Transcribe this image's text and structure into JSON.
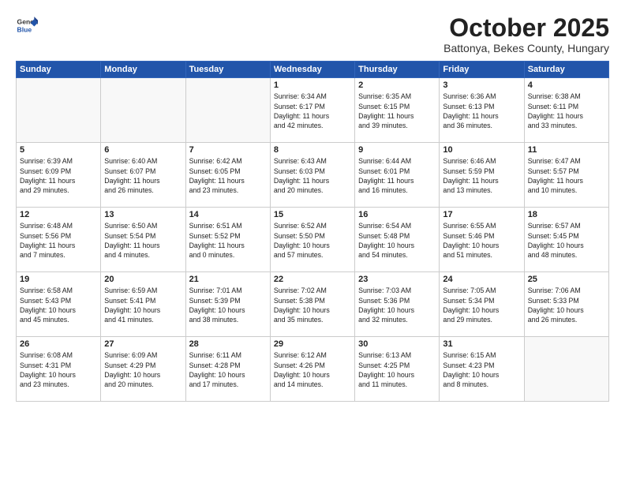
{
  "header": {
    "logo": {
      "line1": "General",
      "line2": "Blue"
    },
    "title": "October 2025",
    "subtitle": "Battonya, Bekes County, Hungary"
  },
  "weekdays": [
    "Sunday",
    "Monday",
    "Tuesday",
    "Wednesday",
    "Thursday",
    "Friday",
    "Saturday"
  ],
  "weeks": [
    [
      {
        "day": "",
        "info": ""
      },
      {
        "day": "",
        "info": ""
      },
      {
        "day": "",
        "info": ""
      },
      {
        "day": "1",
        "info": "Sunrise: 6:34 AM\nSunset: 6:17 PM\nDaylight: 11 hours\nand 42 minutes."
      },
      {
        "day": "2",
        "info": "Sunrise: 6:35 AM\nSunset: 6:15 PM\nDaylight: 11 hours\nand 39 minutes."
      },
      {
        "day": "3",
        "info": "Sunrise: 6:36 AM\nSunset: 6:13 PM\nDaylight: 11 hours\nand 36 minutes."
      },
      {
        "day": "4",
        "info": "Sunrise: 6:38 AM\nSunset: 6:11 PM\nDaylight: 11 hours\nand 33 minutes."
      }
    ],
    [
      {
        "day": "5",
        "info": "Sunrise: 6:39 AM\nSunset: 6:09 PM\nDaylight: 11 hours\nand 29 minutes."
      },
      {
        "day": "6",
        "info": "Sunrise: 6:40 AM\nSunset: 6:07 PM\nDaylight: 11 hours\nand 26 minutes."
      },
      {
        "day": "7",
        "info": "Sunrise: 6:42 AM\nSunset: 6:05 PM\nDaylight: 11 hours\nand 23 minutes."
      },
      {
        "day": "8",
        "info": "Sunrise: 6:43 AM\nSunset: 6:03 PM\nDaylight: 11 hours\nand 20 minutes."
      },
      {
        "day": "9",
        "info": "Sunrise: 6:44 AM\nSunset: 6:01 PM\nDaylight: 11 hours\nand 16 minutes."
      },
      {
        "day": "10",
        "info": "Sunrise: 6:46 AM\nSunset: 5:59 PM\nDaylight: 11 hours\nand 13 minutes."
      },
      {
        "day": "11",
        "info": "Sunrise: 6:47 AM\nSunset: 5:57 PM\nDaylight: 11 hours\nand 10 minutes."
      }
    ],
    [
      {
        "day": "12",
        "info": "Sunrise: 6:48 AM\nSunset: 5:56 PM\nDaylight: 11 hours\nand 7 minutes."
      },
      {
        "day": "13",
        "info": "Sunrise: 6:50 AM\nSunset: 5:54 PM\nDaylight: 11 hours\nand 4 minutes."
      },
      {
        "day": "14",
        "info": "Sunrise: 6:51 AM\nSunset: 5:52 PM\nDaylight: 11 hours\nand 0 minutes."
      },
      {
        "day": "15",
        "info": "Sunrise: 6:52 AM\nSunset: 5:50 PM\nDaylight: 10 hours\nand 57 minutes."
      },
      {
        "day": "16",
        "info": "Sunrise: 6:54 AM\nSunset: 5:48 PM\nDaylight: 10 hours\nand 54 minutes."
      },
      {
        "day": "17",
        "info": "Sunrise: 6:55 AM\nSunset: 5:46 PM\nDaylight: 10 hours\nand 51 minutes."
      },
      {
        "day": "18",
        "info": "Sunrise: 6:57 AM\nSunset: 5:45 PM\nDaylight: 10 hours\nand 48 minutes."
      }
    ],
    [
      {
        "day": "19",
        "info": "Sunrise: 6:58 AM\nSunset: 5:43 PM\nDaylight: 10 hours\nand 45 minutes."
      },
      {
        "day": "20",
        "info": "Sunrise: 6:59 AM\nSunset: 5:41 PM\nDaylight: 10 hours\nand 41 minutes."
      },
      {
        "day": "21",
        "info": "Sunrise: 7:01 AM\nSunset: 5:39 PM\nDaylight: 10 hours\nand 38 minutes."
      },
      {
        "day": "22",
        "info": "Sunrise: 7:02 AM\nSunset: 5:38 PM\nDaylight: 10 hours\nand 35 minutes."
      },
      {
        "day": "23",
        "info": "Sunrise: 7:03 AM\nSunset: 5:36 PM\nDaylight: 10 hours\nand 32 minutes."
      },
      {
        "day": "24",
        "info": "Sunrise: 7:05 AM\nSunset: 5:34 PM\nDaylight: 10 hours\nand 29 minutes."
      },
      {
        "day": "25",
        "info": "Sunrise: 7:06 AM\nSunset: 5:33 PM\nDaylight: 10 hours\nand 26 minutes."
      }
    ],
    [
      {
        "day": "26",
        "info": "Sunrise: 6:08 AM\nSunset: 4:31 PM\nDaylight: 10 hours\nand 23 minutes."
      },
      {
        "day": "27",
        "info": "Sunrise: 6:09 AM\nSunset: 4:29 PM\nDaylight: 10 hours\nand 20 minutes."
      },
      {
        "day": "28",
        "info": "Sunrise: 6:11 AM\nSunset: 4:28 PM\nDaylight: 10 hours\nand 17 minutes."
      },
      {
        "day": "29",
        "info": "Sunrise: 6:12 AM\nSunset: 4:26 PM\nDaylight: 10 hours\nand 14 minutes."
      },
      {
        "day": "30",
        "info": "Sunrise: 6:13 AM\nSunset: 4:25 PM\nDaylight: 10 hours\nand 11 minutes."
      },
      {
        "day": "31",
        "info": "Sunrise: 6:15 AM\nSunset: 4:23 PM\nDaylight: 10 hours\nand 8 minutes."
      },
      {
        "day": "",
        "info": ""
      }
    ]
  ]
}
